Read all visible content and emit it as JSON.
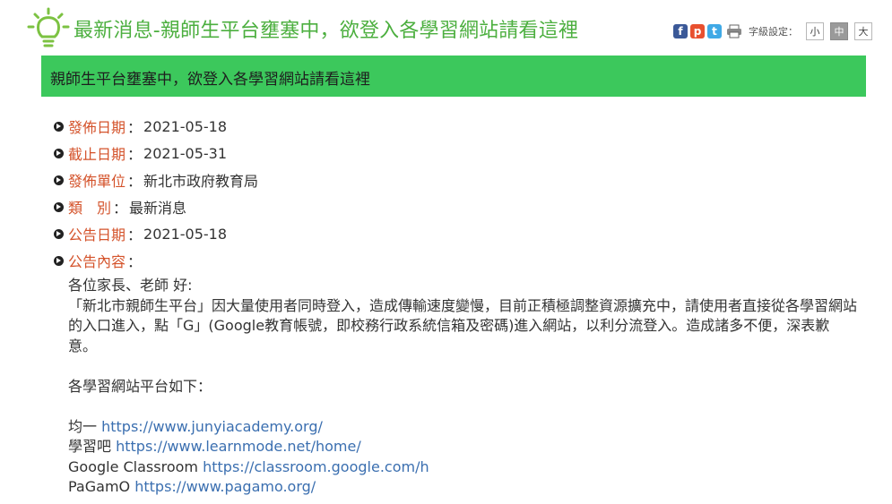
{
  "header": {
    "title": "最新消息-親師生平台壅塞中，欲登入各學習網站請看這裡",
    "share": [
      "f",
      "p",
      "t"
    ],
    "font_size_label": "字級設定：",
    "font_sizes": [
      "小",
      "中",
      "大"
    ]
  },
  "bar": {
    "title": "親師生平台壅塞中，欲登入各學習網站請看這裡"
  },
  "info": [
    {
      "label": "發佈日期",
      "sep": "：",
      "value": "2021-05-18"
    },
    {
      "label": "截止日期",
      "sep": "：",
      "value": "2021-05-31"
    },
    {
      "label": "發佈單位",
      "sep": "：",
      "value": "新北市政府教育局"
    },
    {
      "label": "類　別",
      "sep": "：",
      "value": "最新消息"
    },
    {
      "label": "公告日期",
      "sep": "：",
      "value": "2021-05-18"
    },
    {
      "label": "公告內容",
      "sep": "：",
      "value": ""
    }
  ],
  "content": {
    "greeting": "各位家長、老師 好:",
    "body": "「新北市親師生平台」因大量使用者同時登入，造成傳輸速度變慢，目前正積極調整資源擴充中，請使用者直接從各學習網站的入口進入，點「G」(Google教育帳號，即校務行政系統信箱及密碼)進入網站，以利分流登入。造成諸多不便，深表歉意。",
    "platforms_intro": "各學習網站平台如下：",
    "platforms": [
      {
        "name": "均一",
        "url": "https://www.junyiacademy.org/"
      },
      {
        "name": "學習吧",
        "url": "https://www.learnmode.net/home/"
      },
      {
        "name": "Google Classroom",
        "url": "https://classroom.google.com/h"
      },
      {
        "name": "PaGamO",
        "url": "https://www.pagamo.org/"
      }
    ]
  },
  "colors": {
    "title_green": "#4caf3f",
    "bar_green": "#3cc85c",
    "label_orange": "#d4532b",
    "link_blue": "#3b6fb0"
  },
  "icons": [
    "lightbulb-icon",
    "facebook-icon",
    "plurk-icon",
    "twitter-icon",
    "print-icon",
    "bullet-icon"
  ]
}
